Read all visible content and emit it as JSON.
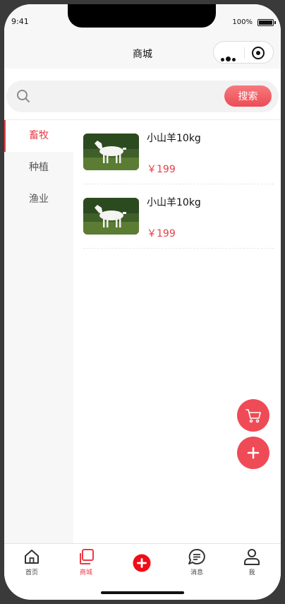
{
  "status": {
    "time": "9:41",
    "battery": "100%"
  },
  "navbar": {
    "title": "商城"
  },
  "search": {
    "placeholder": "",
    "button_label": "搜索"
  },
  "sidebar": {
    "items": [
      {
        "label": "畜牧",
        "active": true
      },
      {
        "label": "种植",
        "active": false
      },
      {
        "label": "渔业",
        "active": false
      }
    ]
  },
  "products": [
    {
      "name": "小山羊10kg",
      "price": "￥199",
      "image": "goat-photo"
    },
    {
      "name": "小山羊10kg",
      "price": "￥199",
      "image": "goat-photo"
    }
  ],
  "tabbar": {
    "items": [
      {
        "label": "首页",
        "icon": "home-icon"
      },
      {
        "label": "商城",
        "icon": "store-icon",
        "active": true
      },
      {
        "label": "",
        "icon": "add-icon"
      },
      {
        "label": "消息",
        "icon": "message-icon"
      },
      {
        "label": "我",
        "icon": "user-icon"
      }
    ]
  },
  "colors": {
    "accent": "#ea3c47",
    "fab": "#ef4b56"
  }
}
